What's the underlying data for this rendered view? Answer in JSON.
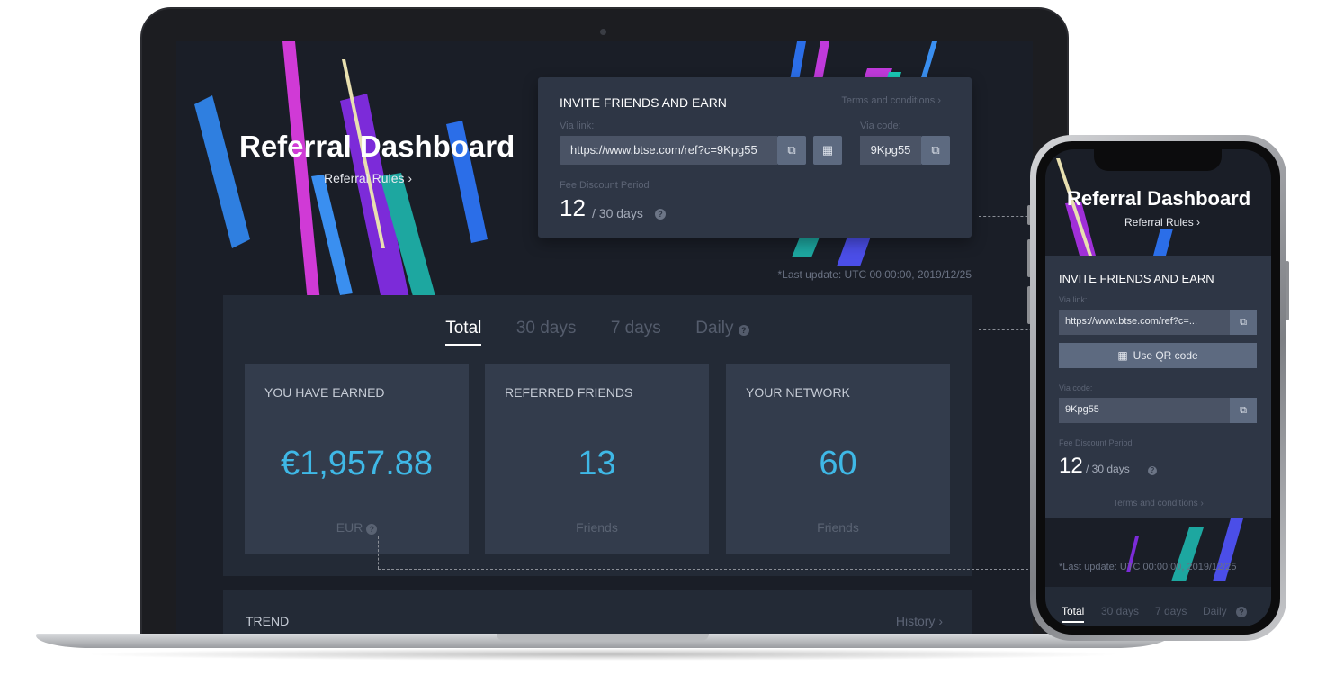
{
  "dashboard": {
    "title": "Referral Dashboard",
    "rules_link": "Referral Rules ›",
    "invite": {
      "title": "INVITE FRIENDS AND EARN",
      "terms": "Terms and conditions ›",
      "via_link_label": "Via link:",
      "link_value": "https://www.btse.com/ref?c=9Kpg55",
      "via_code_label": "Via code:",
      "code_value": "9Kpg55",
      "fee_label": "Fee Discount Period",
      "fee_days": "12",
      "fee_total": "/ 30 days"
    },
    "last_update": "*Last update: UTC 00:00:00, 2019/12/25",
    "tabs": [
      "Total",
      "30 days",
      "7 days",
      "Daily"
    ],
    "stats": [
      {
        "title": "YOU HAVE EARNED",
        "value": "€1,957.88",
        "unit": "EUR"
      },
      {
        "title": "REFERRED FRIENDS",
        "value": "13",
        "unit": "Friends"
      },
      {
        "title": "YOUR NETWORK",
        "value": "60",
        "unit": "Friends"
      }
    ],
    "trend": {
      "title": "TREND",
      "history": "History ›"
    }
  },
  "mobile": {
    "title": "Referral Dashboard",
    "rules_link": "Referral Rules ›",
    "invite_title": "INVITE FRIENDS AND EARN",
    "via_link_label": "Via link:",
    "link_value": "https://www.btse.com/ref?c=...",
    "qr_button": "Use QR code",
    "via_code_label": "Via code:",
    "code_value": "9Kpg55",
    "fee_label": "Fee Discount Period",
    "fee_days": "12",
    "fee_total": "/ 30 days",
    "terms": "Terms and conditions ›",
    "last_update": "*Last update: UTC 00:00:00, 2019/12/25",
    "tabs": [
      "Total",
      "30 days",
      "7 days",
      "Daily"
    ]
  },
  "colors": {
    "accent": "#3fb8e6",
    "background": "#1a1e27",
    "card": "#2e3645",
    "stat_card": "#333c4c"
  },
  "icons": [
    "copy-icon",
    "qr-code-icon",
    "help-icon",
    "chevron-right-icon"
  ]
}
